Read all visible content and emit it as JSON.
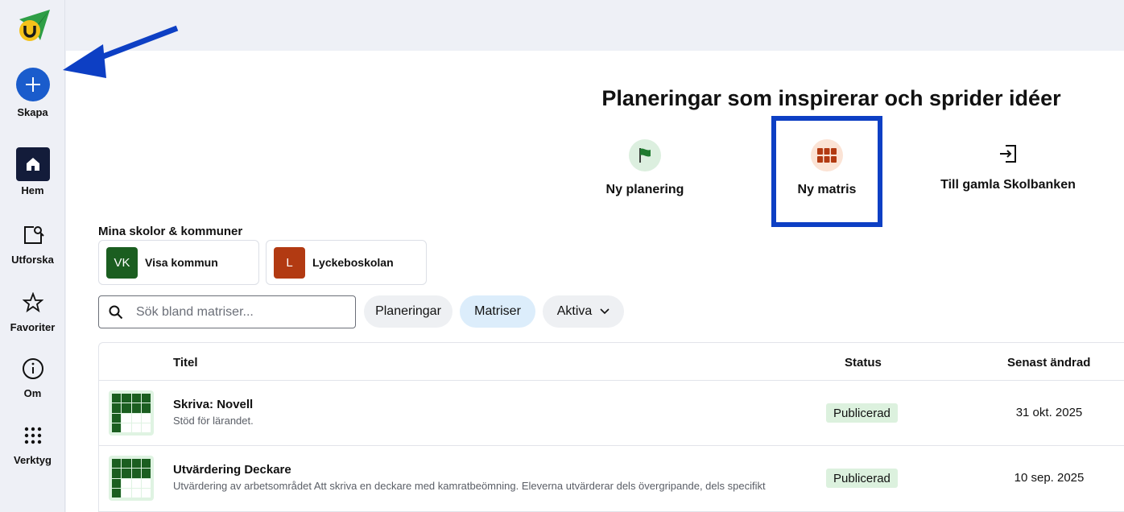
{
  "sidebar": {
    "create_label": "Skapa",
    "items": [
      {
        "label": "Hem",
        "icon": "home-icon"
      },
      {
        "label": "Utforska",
        "icon": "explore-icon"
      },
      {
        "label": "Favoriter",
        "icon": "star-icon"
      },
      {
        "label": "Om",
        "icon": "info-icon"
      },
      {
        "label": "Verktyg",
        "icon": "tools-grid-icon"
      }
    ]
  },
  "hero": {
    "title": "Planeringar som inspirerar och sprider idéer",
    "actions": [
      {
        "label": "Ny planering",
        "icon": "flag-icon"
      },
      {
        "label": "Ny matris",
        "icon": "matrix-icon"
      },
      {
        "label": "Till gamla Skolbanken",
        "icon": "exit-icon"
      }
    ]
  },
  "schools": {
    "heading": "Mina skolor & kommuner",
    "items": [
      {
        "badge": "VK",
        "name": "Visa kommun",
        "color": "#1b5e20"
      },
      {
        "badge": "L",
        "name": "Lyckeboskolan",
        "color": "#b23a12"
      }
    ]
  },
  "search": {
    "placeholder": "Sök bland matriser..."
  },
  "filters": {
    "planeringar": "Planeringar",
    "matriser": "Matriser",
    "aktiva": "Aktiva"
  },
  "table": {
    "headers": {
      "title": "Titel",
      "status": "Status",
      "modified": "Senast ändrad"
    },
    "rows": [
      {
        "title": "Skriva: Novell",
        "description": "Stöd för lärandet.",
        "status": "Publicerad",
        "date": "31 okt. 2025"
      },
      {
        "title": "Utvärdering Deckare",
        "description": "Utvärdering av arbetsområdet Att skriva en deckare med kamratbeömning. Eleverna utvärderar dels övergripande, dels specifikt",
        "status": "Publicerad",
        "date": "10 sep. 2025"
      }
    ]
  },
  "colors": {
    "accent": "#1a5ccc",
    "highlight": "#0d3fc4",
    "status_bg": "#dcf1de"
  }
}
